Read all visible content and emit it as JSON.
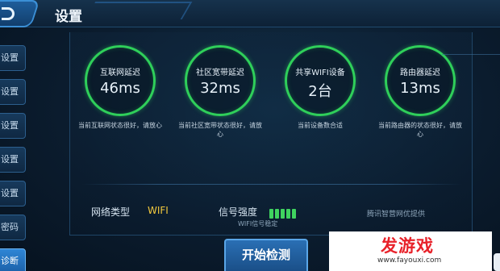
{
  "header": {
    "title": "设置"
  },
  "sidebar": {
    "items": [
      {
        "label": "设置",
        "active": false
      },
      {
        "label": "设置",
        "active": false
      },
      {
        "label": "设置",
        "active": false
      },
      {
        "label": "设置",
        "active": false
      },
      {
        "label": "设置",
        "active": false
      },
      {
        "label": "密码",
        "active": false
      },
      {
        "label": "诊断",
        "active": true
      }
    ]
  },
  "metrics": [
    {
      "label": "互联网延迟",
      "value": "46ms",
      "desc": "当前互联网状态很好，请放心"
    },
    {
      "label": "社区宽带延迟",
      "value": "32ms",
      "desc": "当前社区宽带状态很好，请放心"
    },
    {
      "label": "共享WIFI设备",
      "value": "2台",
      "desc": "当前设备数合适"
    },
    {
      "label": "路由器延迟",
      "value": "13ms",
      "desc": "当前路由器的状态很好，请放心"
    }
  ],
  "network": {
    "type_label": "网络类型",
    "type_value": "WIFI",
    "signal_label": "信号强度",
    "signal_level": 5,
    "signal_max": 5,
    "signal_note": "WIFI信号稳定",
    "provider_note": "腾讯智营网优提供"
  },
  "actions": {
    "start_label": "开始检测"
  },
  "watermark": {
    "logo": "发游戏",
    "url": "www.fayouxi.com"
  },
  "colors": {
    "ring": "#2fcf5a",
    "highlight_value": "#f2c93d",
    "signal_bar": "#3fd35f",
    "watermark_red": "#e8222a"
  }
}
